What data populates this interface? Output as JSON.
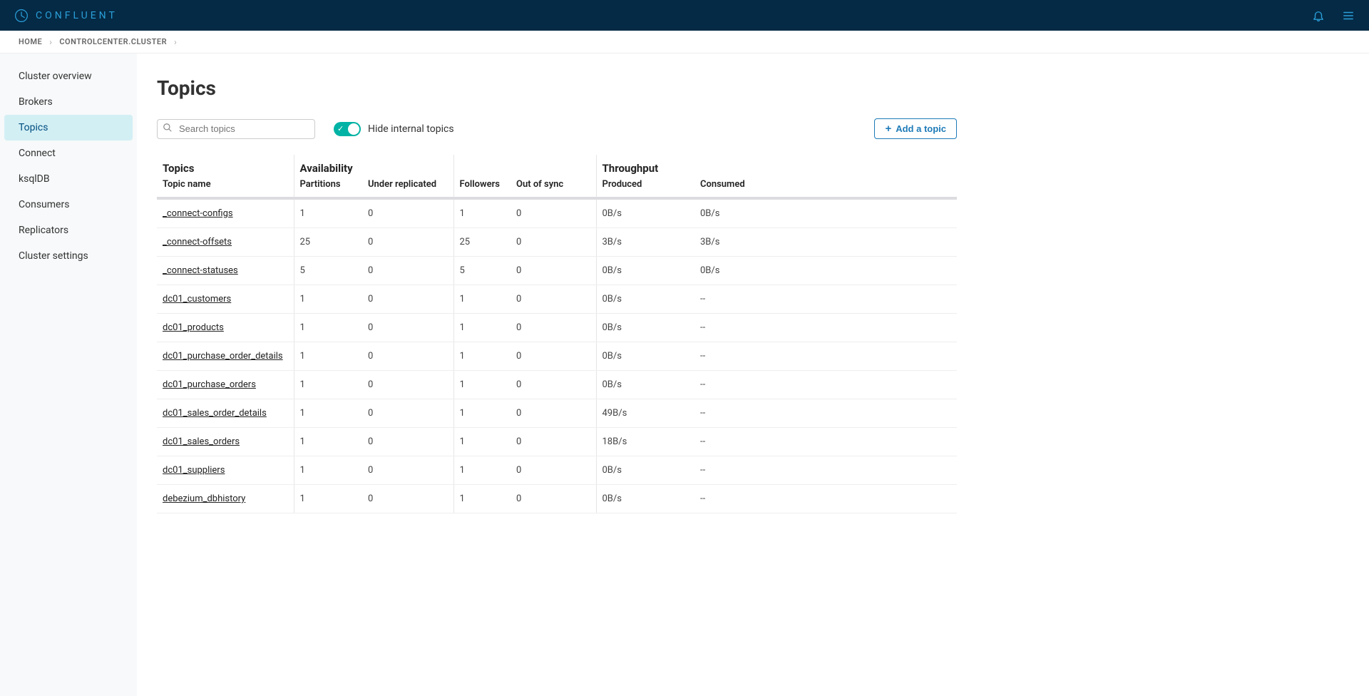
{
  "header": {
    "brand": "CONFLUENT"
  },
  "breadcrumb": {
    "items": [
      "HOME",
      "CONTROLCENTER.CLUSTER"
    ]
  },
  "sidebar": {
    "items": [
      {
        "label": "Cluster overview"
      },
      {
        "label": "Brokers"
      },
      {
        "label": "Topics",
        "active": true
      },
      {
        "label": "Connect"
      },
      {
        "label": "ksqlDB"
      },
      {
        "label": "Consumers"
      },
      {
        "label": "Replicators"
      },
      {
        "label": "Cluster settings"
      }
    ]
  },
  "page": {
    "title": "Topics",
    "search_placeholder": "Search topics",
    "hide_internal_label": "Hide internal topics",
    "hide_internal_on": true,
    "add_topic_label": "Add a topic"
  },
  "table": {
    "groups": {
      "topics": "Topics",
      "availability": "Availability",
      "throughput": "Throughput"
    },
    "columns": {
      "topic_name": "Topic name",
      "partitions": "Partitions",
      "under_replicated": "Under replicated",
      "followers": "Followers",
      "out_of_sync": "Out of sync",
      "produced": "Produced",
      "consumed": "Consumed"
    },
    "rows": [
      {
        "name": "_connect-configs",
        "partitions": "1",
        "under": "0",
        "followers": "1",
        "out": "0",
        "produced": "0B/s",
        "consumed": "0B/s"
      },
      {
        "name": "_connect-offsets",
        "partitions": "25",
        "under": "0",
        "followers": "25",
        "out": "0",
        "produced": "3B/s",
        "consumed": "3B/s"
      },
      {
        "name": "_connect-statuses",
        "partitions": "5",
        "under": "0",
        "followers": "5",
        "out": "0",
        "produced": "0B/s",
        "consumed": "0B/s"
      },
      {
        "name": "dc01_customers",
        "partitions": "1",
        "under": "0",
        "followers": "1",
        "out": "0",
        "produced": "0B/s",
        "consumed": "--"
      },
      {
        "name": "dc01_products",
        "partitions": "1",
        "under": "0",
        "followers": "1",
        "out": "0",
        "produced": "0B/s",
        "consumed": "--"
      },
      {
        "name": "dc01_purchase_order_details",
        "partitions": "1",
        "under": "0",
        "followers": "1",
        "out": "0",
        "produced": "0B/s",
        "consumed": "--"
      },
      {
        "name": "dc01_purchase_orders",
        "partitions": "1",
        "under": "0",
        "followers": "1",
        "out": "0",
        "produced": "0B/s",
        "consumed": "--"
      },
      {
        "name": "dc01_sales_order_details",
        "partitions": "1",
        "under": "0",
        "followers": "1",
        "out": "0",
        "produced": "49B/s",
        "consumed": "--"
      },
      {
        "name": "dc01_sales_orders",
        "partitions": "1",
        "under": "0",
        "followers": "1",
        "out": "0",
        "produced": "18B/s",
        "consumed": "--"
      },
      {
        "name": "dc01_suppliers",
        "partitions": "1",
        "under": "0",
        "followers": "1",
        "out": "0",
        "produced": "0B/s",
        "consumed": "--"
      },
      {
        "name": "debezium_dbhistory",
        "partitions": "1",
        "under": "0",
        "followers": "1",
        "out": "0",
        "produced": "0B/s",
        "consumed": "--"
      }
    ]
  }
}
